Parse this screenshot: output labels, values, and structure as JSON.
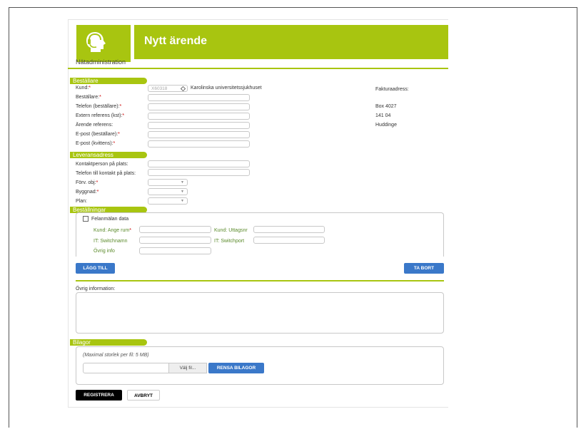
{
  "header": {
    "title": "Nytt ärende",
    "app_name": "Nätadministration"
  },
  "bestallare": {
    "heading": "Beställare",
    "kund_label": "Kund:",
    "kund_code": "X60318",
    "kund_name": "Karolinska universitetssjukhuset",
    "bestallare_label": "Beställare:",
    "telefon_label": "Telefon (beställare):",
    "extern_label": "Extern referens (kst):",
    "arende_label": "Ärende referens:",
    "epost_best_label": "E-post (beställare):",
    "epost_kvitt_label": "E-post (kvittens):",
    "required_mark": "*"
  },
  "faktura": {
    "label": "Fakturaadress:",
    "line1": "Box 4027",
    "line2": "141 04",
    "line3": "Huddinge"
  },
  "leverans": {
    "heading": "Leveransadress",
    "kontakt_label": "Kontaktperson på plats:",
    "telefon_kontakt_label": "Telefon till kontakt på plats:",
    "forv_label": "Förv. obj:",
    "byggnad_label": "Byggnad:",
    "plan_label": "Plan:"
  },
  "bestallningar": {
    "heading": "Beställningar",
    "felanmalan_label": "Felanmälan data",
    "kund_rum_label": "Kund: Ange rum",
    "kund_uttag_label": "Kund: Uttagsnr",
    "switchnamn_label": "IT: Switchnamn",
    "switchport_label": "IT: Switchport",
    "ovrig_info_label": "Övrig info",
    "add_button": "LÄGG TILL",
    "remove_button": "TA BORT"
  },
  "ovrig": {
    "label": "Övrig information:"
  },
  "bilagor": {
    "heading": "Bilagor",
    "max_size": "(Maximal storlek per fil: 5 MB)",
    "choose_file": "Välj fil...",
    "clear_button": "RENSA BILAGOR"
  },
  "actions": {
    "register": "REGISTRERA",
    "cancel": "AVBRYT"
  },
  "colors": {
    "accent": "#a8c510",
    "button_blue": "#3a78c9"
  }
}
